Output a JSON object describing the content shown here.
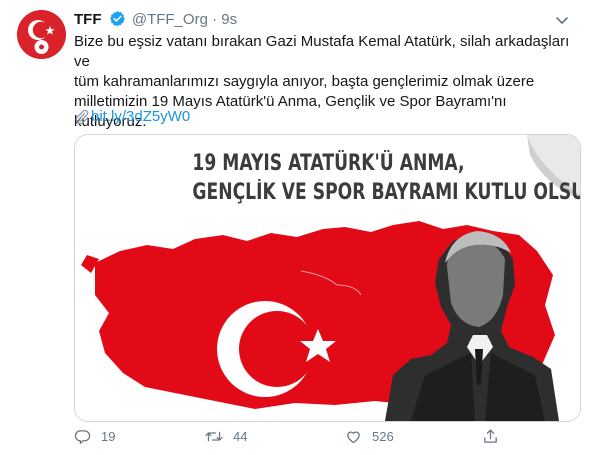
{
  "tweet": {
    "display_name": "TFF",
    "handle": "@TFF_Org",
    "separator": "·",
    "time": "9s",
    "text_lines": [
      "Bize bu eşsiz vatanı bırakan Gazi Mustafa Kemal Atatürk, silah arkadaşları ve",
      "tüm kahramanlarımızı saygıyla anıyor, başta gençlerimiz olmak üzere",
      "milletimizin 19 Mayıs Atatürk'ü Anma, Gençlik ve Spor Bayramı'nı kutluyoruz."
    ],
    "link": "bit.ly/3dZ5yW0"
  },
  "card": {
    "headline_line1": "19 MAYIS ATATÜRK'Ü ANMA,",
    "headline_line2": "GENÇLİK VE SPOR BAYRAMI KUTLU OLSUN"
  },
  "actions": {
    "reply_count": "19",
    "retweet_count": "44",
    "like_count": "526"
  },
  "colors": {
    "brand_red": "#e30a17",
    "link_blue": "#1b95e0",
    "muted": "#657786"
  },
  "icons": [
    "tff-logo",
    "verified-badge-icon",
    "chevron-down-icon",
    "paperclip-icon",
    "reply-icon",
    "retweet-icon",
    "like-icon",
    "share-icon"
  ]
}
